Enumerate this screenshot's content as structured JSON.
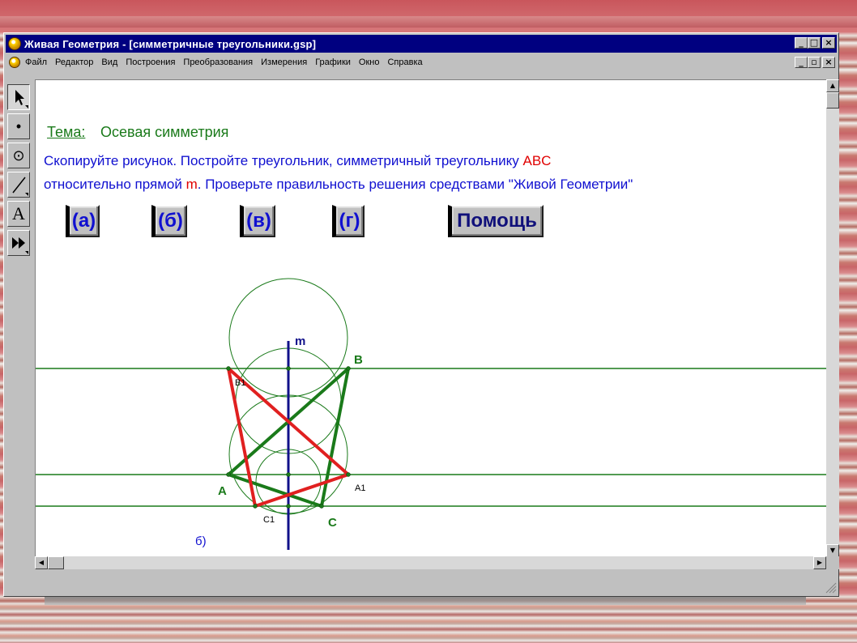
{
  "window": {
    "title": "Живая Геометрия - [симметричные треугольники.gsp]",
    "controls": [
      "_",
      "□",
      "×"
    ],
    "doc_controls": [
      "_",
      "▫",
      "×"
    ]
  },
  "menu": {
    "items": [
      "Файл",
      "Редактор",
      "Вид",
      "Построения",
      "Преобразования",
      "Измерения",
      "Графики",
      "Окно",
      "Справка"
    ]
  },
  "toolbox": {
    "tools": [
      {
        "name": "selection-arrow-tool",
        "glyph": "↖"
      },
      {
        "name": "point-tool",
        "glyph": "•"
      },
      {
        "name": "compass-tool",
        "glyph": "⊙"
      },
      {
        "name": "straightedge-tool",
        "glyph": "/"
      },
      {
        "name": "text-tool",
        "glyph": "A"
      },
      {
        "name": "custom-tool",
        "glyph": "⏵⏵"
      }
    ]
  },
  "content": {
    "tema_label": "Тема:",
    "tema_value": "Осевая симметрия",
    "task_line1_prefix": "Скопируйте рисунок. Постройте треугольник, симметричный треугольнику ",
    "task_line1_highlight": "ABC",
    "task_line2_prefix": "относительно прямой ",
    "task_line2_highlight": "m",
    "task_line2_suffix": ". Проверьте правильность решения средствами \"Живой Геометрии\"",
    "buttons": [
      "(а)",
      "(б)",
      "(в)",
      "(г)"
    ],
    "help_button": "Помощь"
  },
  "drawing": {
    "axis_label": "m",
    "points": {
      "A": "A",
      "B": "B",
      "C": "C",
      "A1": "A1",
      "B1": "B1",
      "C1": "C1"
    },
    "caption": "б)",
    "colors": {
      "original_triangle": "#1a7a1a",
      "symmetric_triangle": "#e02020",
      "axis": "#10108a",
      "construction": "#1a7a1a",
      "task_text": "#1010d0",
      "highlight": "#e00000"
    }
  }
}
